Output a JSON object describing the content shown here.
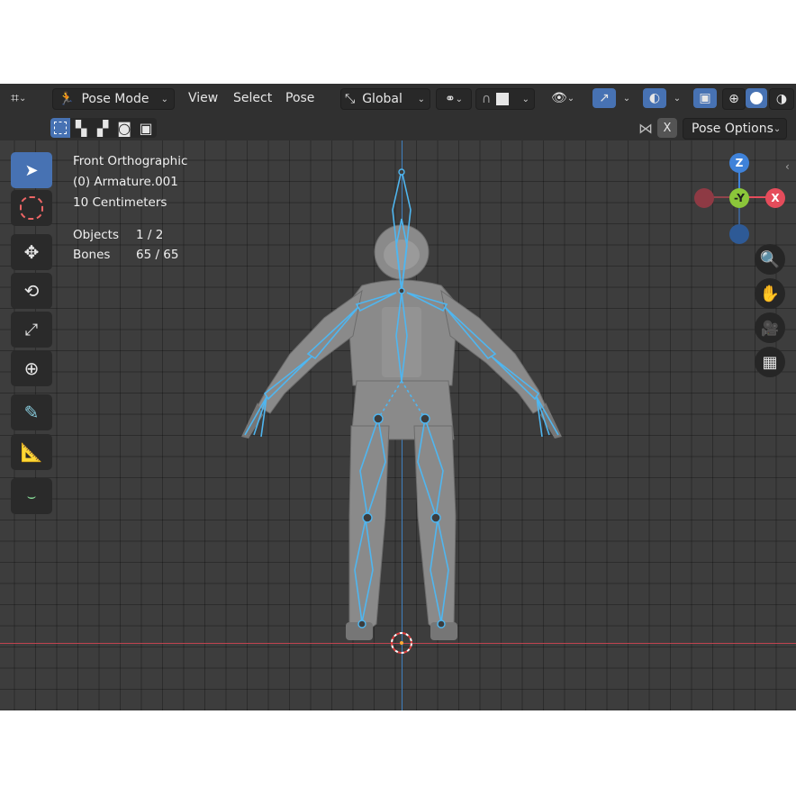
{
  "header": {
    "mode_label": "Pose Mode",
    "menus": [
      "View",
      "Select",
      "Pose"
    ],
    "transform_orientation": "Global",
    "pose_options_label": "Pose Options",
    "x_label": "X"
  },
  "overlay": {
    "view_name": "Front Orthographic",
    "object_name": "(0) Armature.001",
    "scale": "10 Centimeters",
    "objects_label": "Objects",
    "objects_value": "1 / 2",
    "bones_label": "Bones",
    "bones_value": "65 / 65"
  },
  "gizmo": {
    "z_label": "Z",
    "y_label": "-Y",
    "x_label": "X"
  },
  "icons": [
    "editor-type-icon",
    "pose-mode-icon",
    "transform-orientation-icon",
    "pivot-icon",
    "snap-icon",
    "proportional-icon",
    "visibility-icon",
    "gizmo-icon",
    "overlay-icon",
    "xray-icon",
    "wireframe-shading-icon",
    "solid-shading-icon",
    "material-shading-icon",
    "select-box-icon",
    "cursor-icon",
    "move-icon",
    "rotate-icon",
    "scale-icon",
    "transform-icon",
    "annotate-icon",
    "measure-icon",
    "relax-icon",
    "zoom-icon",
    "hand-icon",
    "camera-icon",
    "grid-icon"
  ],
  "colors": {
    "accent": "#4772b3",
    "bone": "#4fb6f0",
    "x_axis": "#e54c5b",
    "y_axis": "#8bc63a",
    "z_axis": "#3f82d9",
    "viewport_bg": "#3d3d3d"
  }
}
